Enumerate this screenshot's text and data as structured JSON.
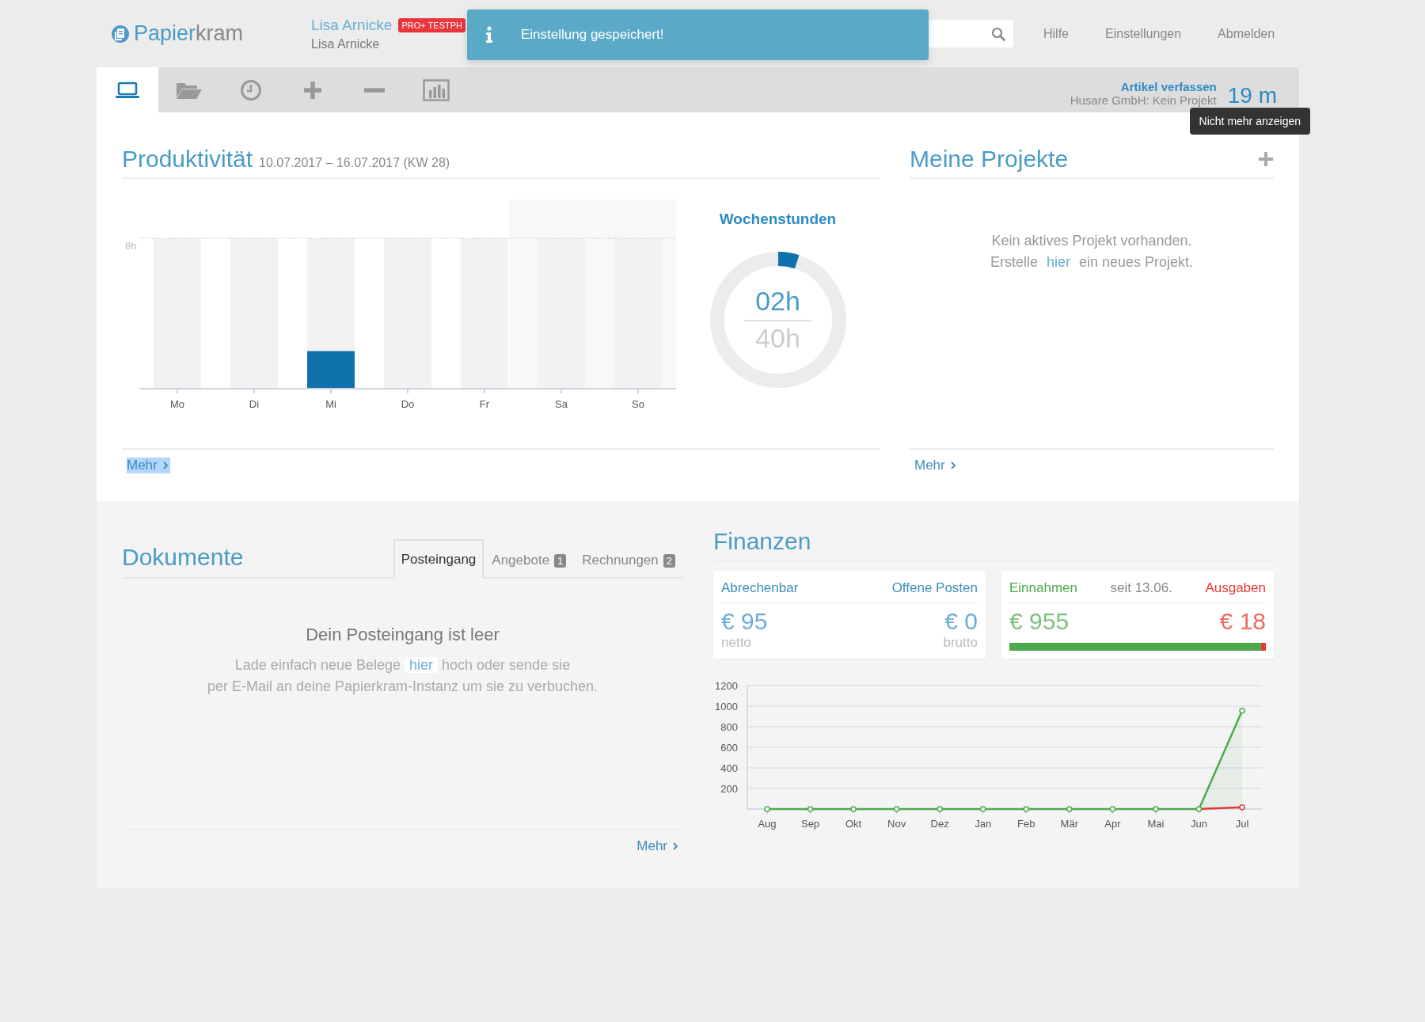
{
  "header": {
    "logo": {
      "text_1": "Papier",
      "text_2": "kram"
    },
    "user_name": "Lisa Arnicke",
    "user_subtitle": "Lisa Arnicke",
    "plan_badge": "PRO+ TESTPH",
    "links": [
      "Hilfe",
      "Einstellungen",
      "Abmelden"
    ]
  },
  "toast": {
    "message": "Einstellung gespeichert!"
  },
  "toolbar": {
    "tools": [
      {
        "kind": "laptop",
        "selected": true
      },
      {
        "kind": "folder",
        "selected": false
      },
      {
        "kind": "clock",
        "selected": false
      },
      {
        "kind": "plus",
        "selected": false
      },
      {
        "kind": "minus",
        "selected": false
      },
      {
        "kind": "chart",
        "selected": false
      }
    ],
    "timer": {
      "task": "Artikel verfassen",
      "project": "Husare GmbH: Kein Projekt",
      "elapsed": "19 m"
    },
    "tooltip": "Nicht mehr anzeigen"
  },
  "productivity": {
    "title": "Produktivität",
    "period": "10.07.2017 – 16.07.2017 (KW 28)",
    "chart": {
      "days": [
        "Mo",
        "Di",
        "Mi",
        "Do",
        "Fr",
        "Sa",
        "So"
      ],
      "scale_label": "8h"
    },
    "weekly": {
      "title": "Wochenstunden",
      "level": 0.05,
      "hours": "02h",
      "target": "40h"
    },
    "more": "Mehr"
  },
  "projects": {
    "title": "Meine Projekte",
    "empty_line_1": "Kein aktives Projekt vorhanden.",
    "empty_line_2": {
      "before": "Erstelle",
      "link": "hier",
      "after": "ein neues Projekt."
    },
    "more": "Mehr"
  },
  "documents": {
    "title": "Dokumente",
    "tabs": [
      {
        "label": "Posteingang",
        "selected": true
      },
      {
        "label": "Angebote",
        "badge": "1",
        "selected": false
      },
      {
        "label": "Rechnungen",
        "badge": "2",
        "selected": false
      }
    ],
    "empty_title": "Dein Posteingang ist leer",
    "empty_text": {
      "before": "Lade einfach neue Belege",
      "link": "hier",
      "after": "hoch oder sende sie",
      "line_2": "per E-Mail an deine Papierkram-Instanz um sie zu verbuchen."
    },
    "more": "Mehr"
  },
  "finance": {
    "title": "Finanzen",
    "billable": {
      "label": "Abrechenbar",
      "amount": "€ 95",
      "note": "netto"
    },
    "open_items": {
      "label": "Offene Posten",
      "amount": "€ 0",
      "note": "brutto"
    },
    "income": {
      "amount": "€ 955"
    },
    "since": "seit 13.06.",
    "expenses": {
      "amount": "€ 18"
    },
    "income_bar": {
      "level": 0.98
    },
    "chart_data": {
      "type": "line",
      "categories": [
        "Aug",
        "Sep",
        "Okt",
        "Nov",
        "Dez",
        "Jan",
        "Feb",
        "Mär",
        "Apr",
        "Mai",
        "Jun",
        "Jul"
      ],
      "series": [
        {
          "name": "Einnahmen",
          "color": "#4caa4c",
          "marker": true,
          "values": [
            0,
            0,
            0,
            0,
            0,
            0,
            0,
            0,
            0,
            0,
            0,
            955
          ]
        },
        {
          "name": "Ausgaben",
          "color": "#e53935",
          "marker": true,
          "values": [
            null,
            null,
            null,
            null,
            null,
            null,
            null,
            null,
            null,
            null,
            0,
            18
          ]
        }
      ],
      "grid": true,
      "ylim": [
        0,
        1200
      ],
      "yticks": [
        200,
        400,
        600,
        800,
        1000,
        1200
      ]
    }
  }
}
